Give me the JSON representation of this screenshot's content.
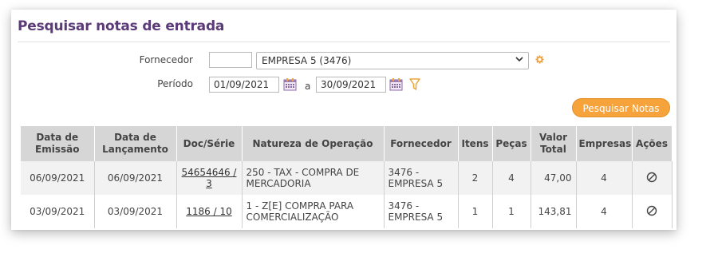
{
  "page": {
    "title": "Pesquisar notas de entrada"
  },
  "filters": {
    "fornecedor_label": "Fornecedor",
    "fornecedor_code": "",
    "fornecedor_value": "EMPRESA 5 (3476)",
    "periodo_label": "Período",
    "date_from": "01/09/2021",
    "date_sep": "a",
    "date_to": "30/09/2021"
  },
  "actions": {
    "search_label": "Pesquisar Notas"
  },
  "table": {
    "headers": {
      "emissao": "Data de Emissão",
      "lancamento": "Data de Lançamento",
      "doc": "Doc/Série",
      "natureza": "Natureza de Operação",
      "fornecedor": "Fornecedor",
      "itens": "Itens",
      "pecas": "Peças",
      "valor": "Valor Total",
      "empresas": "Empresas",
      "acoes": "Ações"
    },
    "rows": [
      {
        "emissao": "06/09/2021",
        "lancamento": "06/09/2021",
        "doc": "54654646 / 3",
        "natureza": "250 - TAX - COMPRA DE MERCADORIA",
        "fornecedor": "3476 - EMPRESA 5",
        "itens": "2",
        "pecas": "4",
        "valor": "47,00",
        "empresas": "4"
      },
      {
        "emissao": "03/09/2021",
        "lancamento": "03/09/2021",
        "doc": "1186 / 10",
        "natureza": "1 - Z[E] COMPRA PARA COMERCIALIZAÇÃO",
        "fornecedor": "3476 - EMPRESA 5",
        "itens": "1",
        "pecas": "1",
        "valor": "143,81",
        "empresas": "4"
      }
    ]
  },
  "icons": {
    "required_marker": "gear-icon",
    "calendar": "calendar-icon",
    "filter": "funnel-icon",
    "row_action": "no-action-icon"
  },
  "colors": {
    "title": "#5b3a78",
    "button": "#f7a33b",
    "header_bg": "#d6d6d6"
  }
}
